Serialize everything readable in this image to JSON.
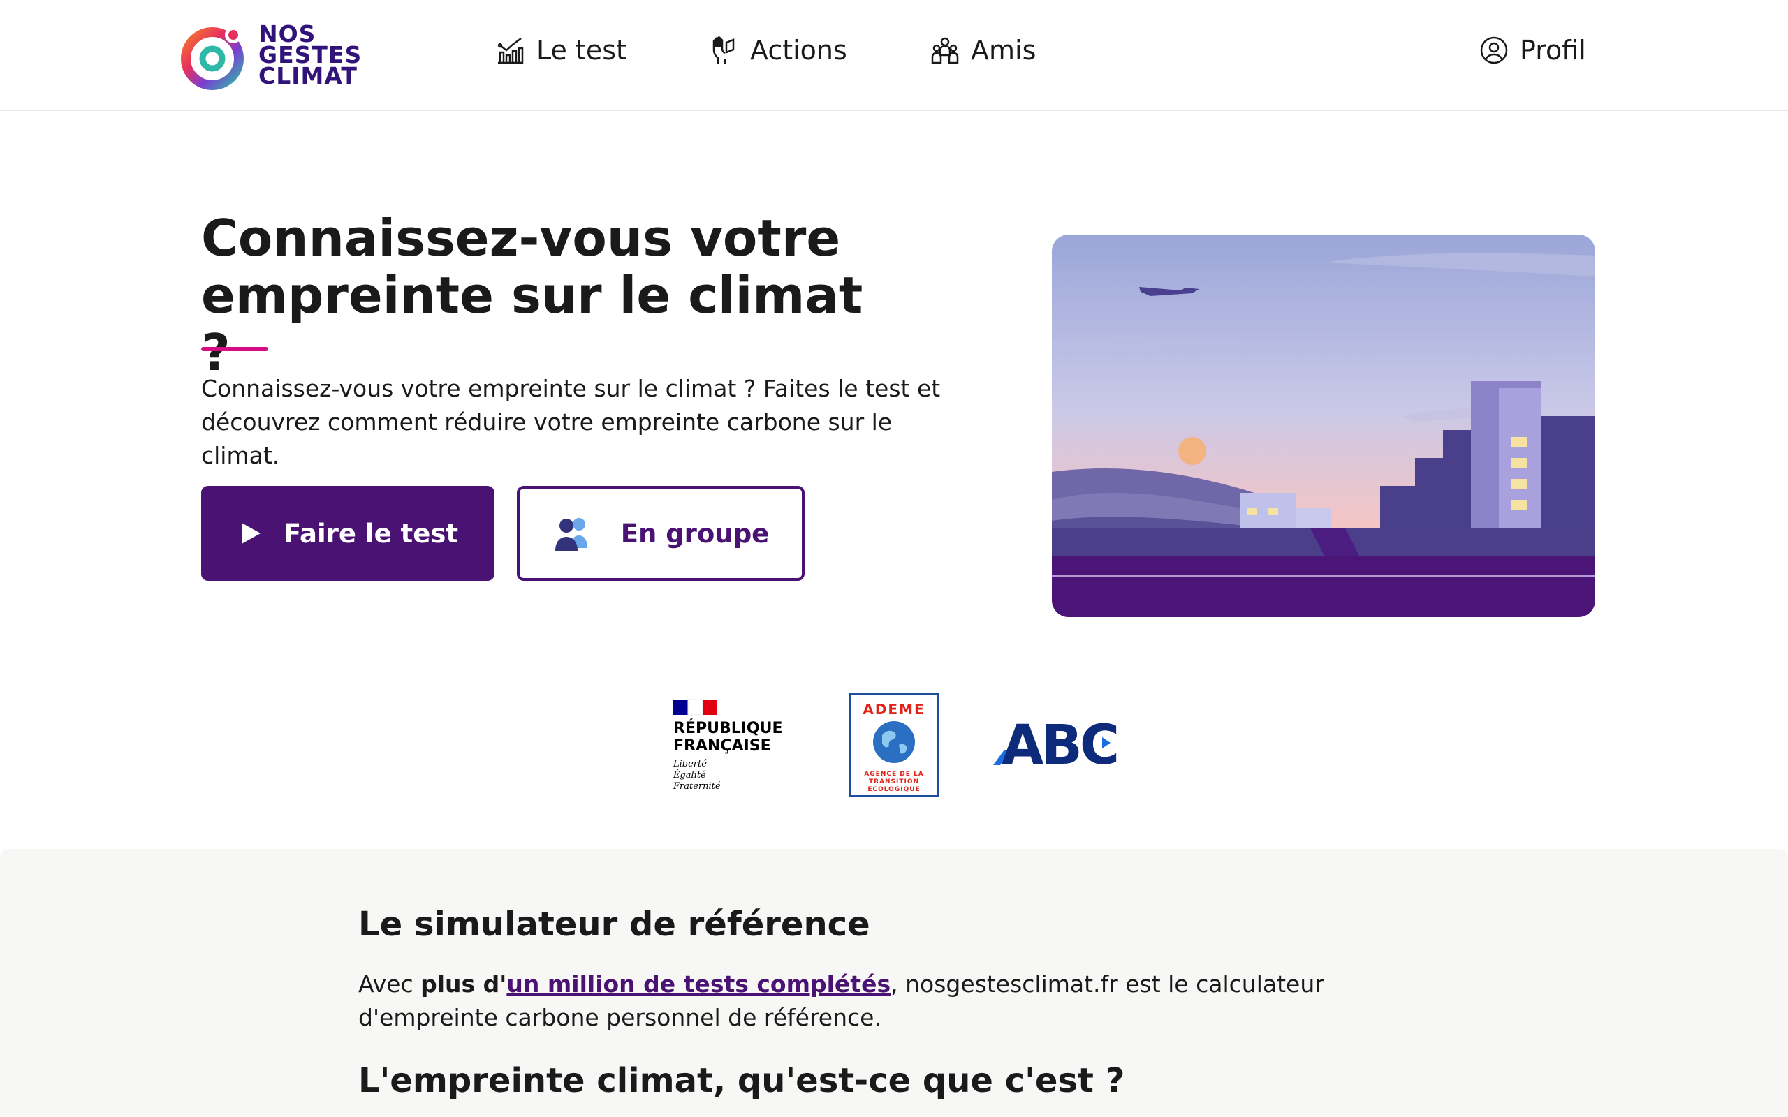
{
  "brand": {
    "logo_line1": "NOS",
    "logo_line2": "GESTES",
    "logo_line3": "CLIMAT",
    "color_primary": "#491273",
    "color_accent": "#d40d83"
  },
  "nav": {
    "items": [
      {
        "label": "Le test",
        "icon": "chart-icon"
      },
      {
        "label": "Actions",
        "icon": "gesture-hand-icon"
      },
      {
        "label": "Amis",
        "icon": "group-icon"
      }
    ],
    "profile_label": "Profil",
    "profile_icon": "user-circle-icon"
  },
  "hero": {
    "title": "Connaissez-vous votre empreinte sur le climat ?",
    "description": "Connaissez-vous votre empreinte sur le climat ? Faites le test et découvrez comment réduire votre empreinte carbone sur le climat.",
    "primary_button": "Faire le test",
    "secondary_button": "En groupe"
  },
  "partners": {
    "rf_line1": "RÉPUBLIQUE",
    "rf_line2": "FRANÇAISE",
    "rf_motto1": "Liberté",
    "rf_motto2": "Égalité",
    "rf_motto3": "Fraternité",
    "ademe_title": "ADEME",
    "ademe_sub1": "AGENCE DE LA",
    "ademe_sub2": "TRANSITION",
    "ademe_sub3": "ÉCOLOGIQUE",
    "abc_text": "ABC"
  },
  "info": {
    "heading1": "Le simulateur de référence",
    "p1_before": "Avec ",
    "p1_bold": "plus d'",
    "p1_link": "un million de tests complétés",
    "p1_after": ", nosgestesclimat.fr est le calculateur d'empreinte carbone personnel de référence.",
    "heading2": "L'empreinte climat, qu'est-ce que c'est ?"
  }
}
